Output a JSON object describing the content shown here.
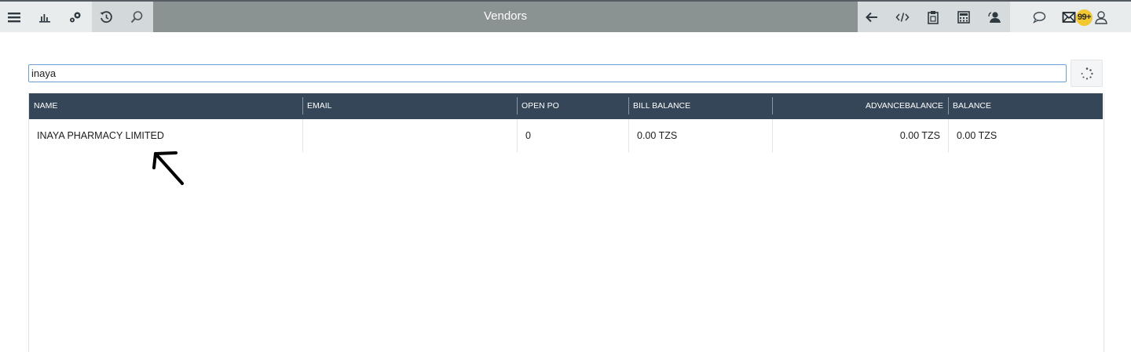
{
  "header": {
    "title": "Vendors"
  },
  "toolbar": {
    "left_icons": [
      "menu-icon",
      "chart-icon",
      "gears-icon",
      "history-icon",
      "search-icon"
    ],
    "right_icons": [
      "back-arrow-icon",
      "code-icon",
      "clipboard-icon",
      "calculator-icon",
      "user-support-icon",
      "chat-icon",
      "mail-icon",
      "profile-icon"
    ],
    "mail_badge": "99+"
  },
  "search": {
    "value": "inaya"
  },
  "table": {
    "columns": [
      "NAME",
      "EMAIL",
      "OPEN PO",
      "BILL BALANCE",
      "ADVANCEBALANCE",
      "BALANCE"
    ],
    "rows": [
      {
        "name": "INAYA PHARMACY LIMITED",
        "email": "",
        "open_po": "0",
        "bill_balance": "0.00 TZS",
        "advance_balance": "0.00 TZS",
        "balance": "0.00 TZS"
      }
    ]
  },
  "colors": {
    "topbar": "#8a9292",
    "grid_header": "#354658",
    "badge": "#f2c730",
    "search_border": "#6b9fd4"
  }
}
